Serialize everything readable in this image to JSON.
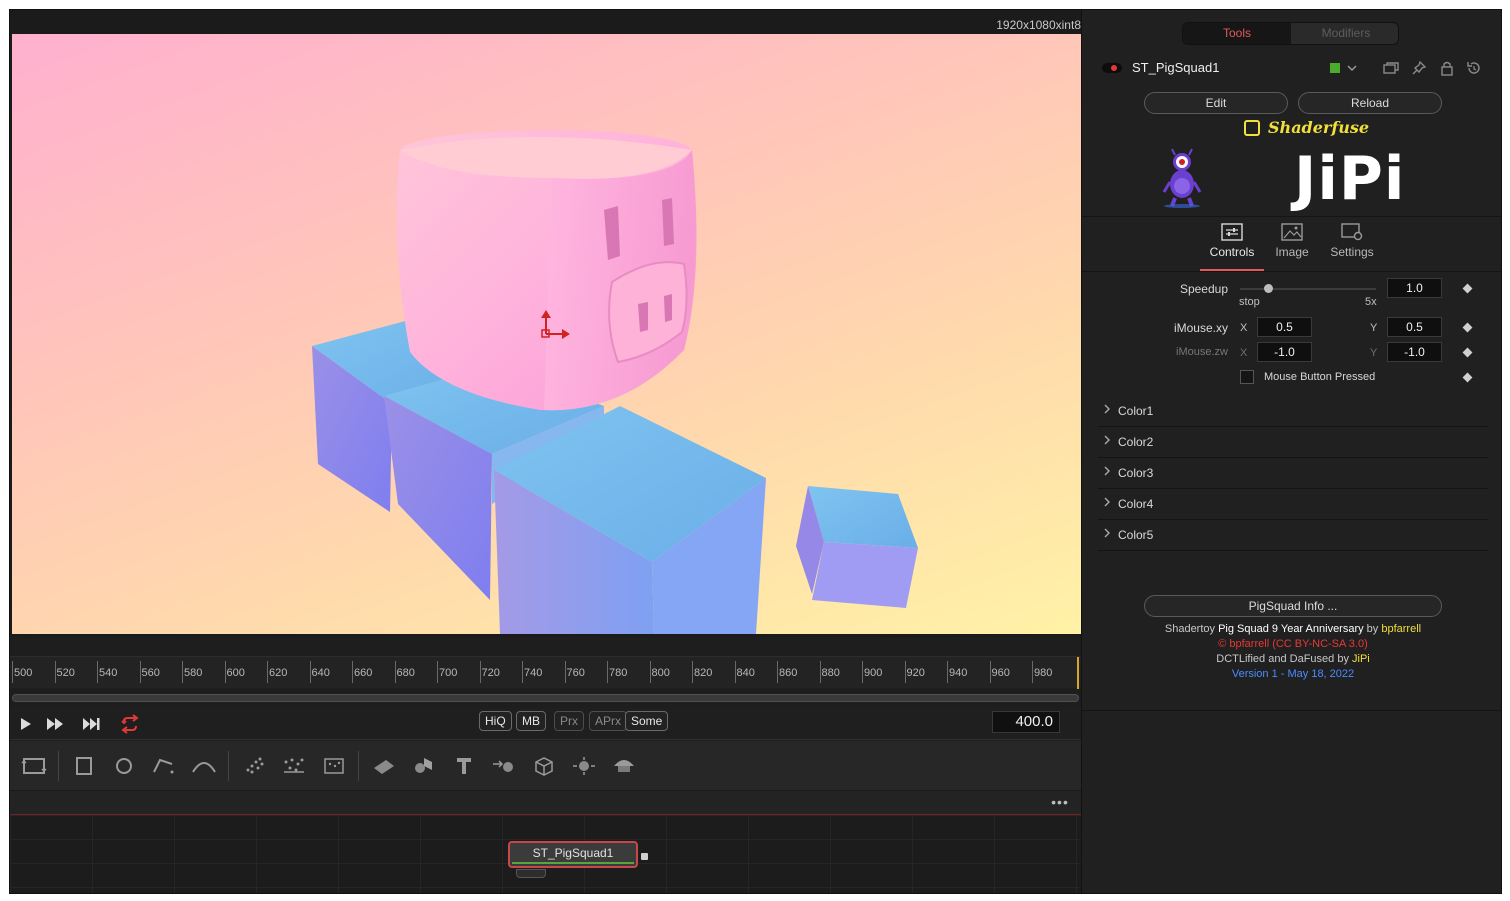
{
  "viewer": {
    "resolution": "1920x1080xint8"
  },
  "ruler": {
    "ticks": [
      "500",
      "520",
      "540",
      "560",
      "580",
      "600",
      "620",
      "640",
      "660",
      "680",
      "700",
      "720",
      "740",
      "760",
      "780",
      "800",
      "820",
      "840",
      "860",
      "880",
      "900",
      "920",
      "940",
      "960",
      "980"
    ]
  },
  "transport": {
    "quality_buttons": [
      "HiQ",
      "MB",
      "Prx",
      "APrx",
      "Some"
    ],
    "current_frame": "400.0"
  },
  "node_editor": {
    "more": "•••",
    "node_label": "ST_PigSquad1"
  },
  "inspector": {
    "tabs": {
      "tools": "Tools",
      "modifiers": "Modifiers"
    },
    "tool_name": "ST_PigSquad1",
    "tool_color": "#4caa2c",
    "edit_label": "Edit",
    "reload_label": "Reload",
    "brand": "Shaderfuse",
    "author_logo": "JiPi",
    "control_tabs": [
      "Controls",
      "Image",
      "Settings"
    ],
    "controls": {
      "speedup_label": "Speedup",
      "speedup_value": "1.0",
      "speedup_min": "stop",
      "speedup_max": "5x",
      "imouse_xy_label": "iMouse.xy",
      "imouse_zw_label": "iMouse.zw",
      "x_label": "X",
      "y_label": "Y",
      "imouse_x": "0.5",
      "imouse_y": "0.5",
      "imouse_z": "-1.0",
      "imouse_w": "-1.0",
      "mouse_button_label": "Mouse Button Pressed"
    },
    "groups": [
      "Color1",
      "Color2",
      "Color3",
      "Color4",
      "Color5"
    ],
    "info_button": "PigSquad Info ...",
    "info": {
      "l1_a": "Shadertoy ",
      "l1_b": "Pig Squad 9 Year Anniversary",
      "l1_c": " by ",
      "l1_d": "bpfarrell",
      "l2": "© bpfarrell (CC BY-NC-SA 3.0)",
      "l3_a": "DCTLified and DaFused by ",
      "l3_b": "JiPi",
      "l4": "Version 1 - May 18, 2022"
    }
  },
  "colors": {
    "accent_red": "#e05a5a",
    "brand_yellow": "#f1df3c",
    "link_blue": "#4a8cff"
  }
}
